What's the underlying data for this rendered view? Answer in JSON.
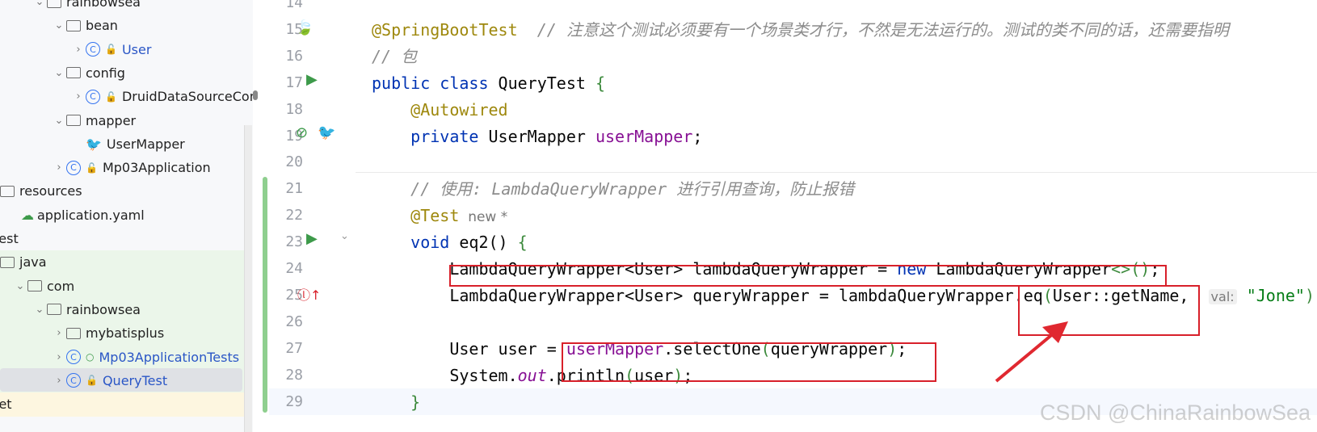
{
  "sidebar": {
    "items": [
      {
        "label": "rainbowsea",
        "type": "package",
        "chev": "v",
        "indent": 40,
        "y": -12
      },
      {
        "label": "bean",
        "type": "package",
        "chev": "v",
        "indent": 64
      },
      {
        "label": "User",
        "type": "class",
        "chev": ">",
        "indent": 88,
        "blue": true
      },
      {
        "label": "config",
        "type": "package",
        "chev": "v",
        "indent": 64
      },
      {
        "label": "DruidDataSourceConfig",
        "type": "class",
        "chev": ">",
        "indent": 88
      },
      {
        "label": "mapper",
        "type": "package",
        "chev": "v",
        "indent": 64
      },
      {
        "label": "UserMapper",
        "type": "mapper",
        "chev": "",
        "indent": 88
      },
      {
        "label": "Mp03Application",
        "type": "app",
        "chev": ">",
        "indent": 64
      },
      {
        "label": "resources",
        "type": "resources",
        "chev": "",
        "indent": 0
      },
      {
        "label": "application.yaml",
        "type": "yaml",
        "chev": "",
        "indent": 26
      },
      {
        "label": "test",
        "type": "text",
        "chev": "",
        "indent": -8
      },
      {
        "label": "java",
        "type": "folder",
        "chev": "",
        "indent": 0
      },
      {
        "label": "com",
        "type": "package",
        "chev": "v",
        "indent": 16
      },
      {
        "label": "rainbowsea",
        "type": "package",
        "chev": "v",
        "indent": 40
      },
      {
        "label": "mybatisplus",
        "type": "package",
        "chev": ">",
        "indent": 64
      },
      {
        "label": "Mp03ApplicationTests",
        "type": "testclass",
        "chev": ">",
        "indent": 64,
        "blue": true
      },
      {
        "label": "QueryTest",
        "type": "testclass",
        "chev": ">",
        "indent": 64,
        "blue": true,
        "selected": true
      },
      {
        "label": "rget",
        "type": "text",
        "chev": "",
        "indent": -18
      }
    ]
  },
  "editor": {
    "line_numbers": [
      "14",
      "15",
      "16",
      "17",
      "18",
      "19",
      "20",
      "21",
      "22",
      "23",
      "24",
      "25",
      "26",
      "27",
      "28",
      "29"
    ],
    "lines": [
      [],
      [
        {
          "t": "@SpringBootTest",
          "c": "a"
        },
        {
          "t": "  // 注意这个测试必须要有一个场景类才行，不然是无法运行的。测试的类不同的话，还需要指明",
          "c": "c"
        }
      ],
      [
        {
          "t": "// 包",
          "c": "c"
        }
      ],
      [
        {
          "t": "public class ",
          "c": "k"
        },
        {
          "t": "QueryTest "
        },
        {
          "t": "{",
          "c": "g"
        }
      ],
      [
        {
          "t": "    "
        },
        {
          "t": "@Autowired",
          "c": "a"
        }
      ],
      [
        {
          "t": "    "
        },
        {
          "t": "private ",
          "c": "k"
        },
        {
          "t": "UserMapper "
        },
        {
          "t": "userMapper",
          "c": "f"
        },
        {
          "t": ";"
        }
      ],
      [],
      [
        {
          "t": "    "
        },
        {
          "t": "// 使用: LambdaQueryWrapper 进行引用查询，防止报错",
          "c": "c"
        }
      ],
      [
        {
          "t": "    "
        },
        {
          "t": "@Test",
          "c": "a"
        },
        {
          "t": "  new *",
          "c": "inlay2"
        }
      ],
      [
        {
          "t": "    "
        },
        {
          "t": "void ",
          "c": "k"
        },
        {
          "t": "eq2() "
        },
        {
          "t": "{",
          "c": "g"
        }
      ],
      [
        {
          "t": "        LambdaQueryWrapper<User> lambdaQueryWrapper = "
        },
        {
          "t": "new ",
          "c": "k"
        },
        {
          "t": "LambdaQueryWrapper"
        },
        {
          "t": "<>()",
          "c": "g"
        },
        {
          "t": ";"
        }
      ],
      [
        {
          "t": "        LambdaQueryWrapper<User> queryWrapper = lambdaQueryWrapper.eq"
        },
        {
          "t": "(",
          "c": "g"
        },
        {
          "t": "User::getName,  "
        },
        {
          "t": "val:",
          "c": "inlay"
        },
        {
          "t": " "
        },
        {
          "t": "\"Jone\"",
          "c": "s"
        },
        {
          "t": ")",
          "c": "g"
        },
        {
          "t": ";"
        }
      ],
      [],
      [
        {
          "t": "        User user = "
        },
        {
          "t": "userMapper",
          "c": "f"
        },
        {
          "t": ".selectOne"
        },
        {
          "t": "(",
          "c": "g"
        },
        {
          "t": "queryWrapper"
        },
        {
          "t": ")",
          "c": "g"
        },
        {
          "t": ";"
        }
      ],
      [
        {
          "t": "        System."
        },
        {
          "t": "out",
          "c": "it"
        },
        {
          "t": ".println"
        },
        {
          "t": "(",
          "c": "g"
        },
        {
          "t": "user"
        },
        {
          "t": ")",
          "c": "g"
        },
        {
          "t": ";"
        }
      ],
      [
        {
          "t": "    "
        },
        {
          "t": "}",
          "c": "g"
        }
      ]
    ]
  },
  "watermark": "CSDN @ChinaRainbowSea",
  "colors": {
    "annotation_box": "#d8202a",
    "keyword": "#0033b3",
    "string": "#067d17"
  }
}
